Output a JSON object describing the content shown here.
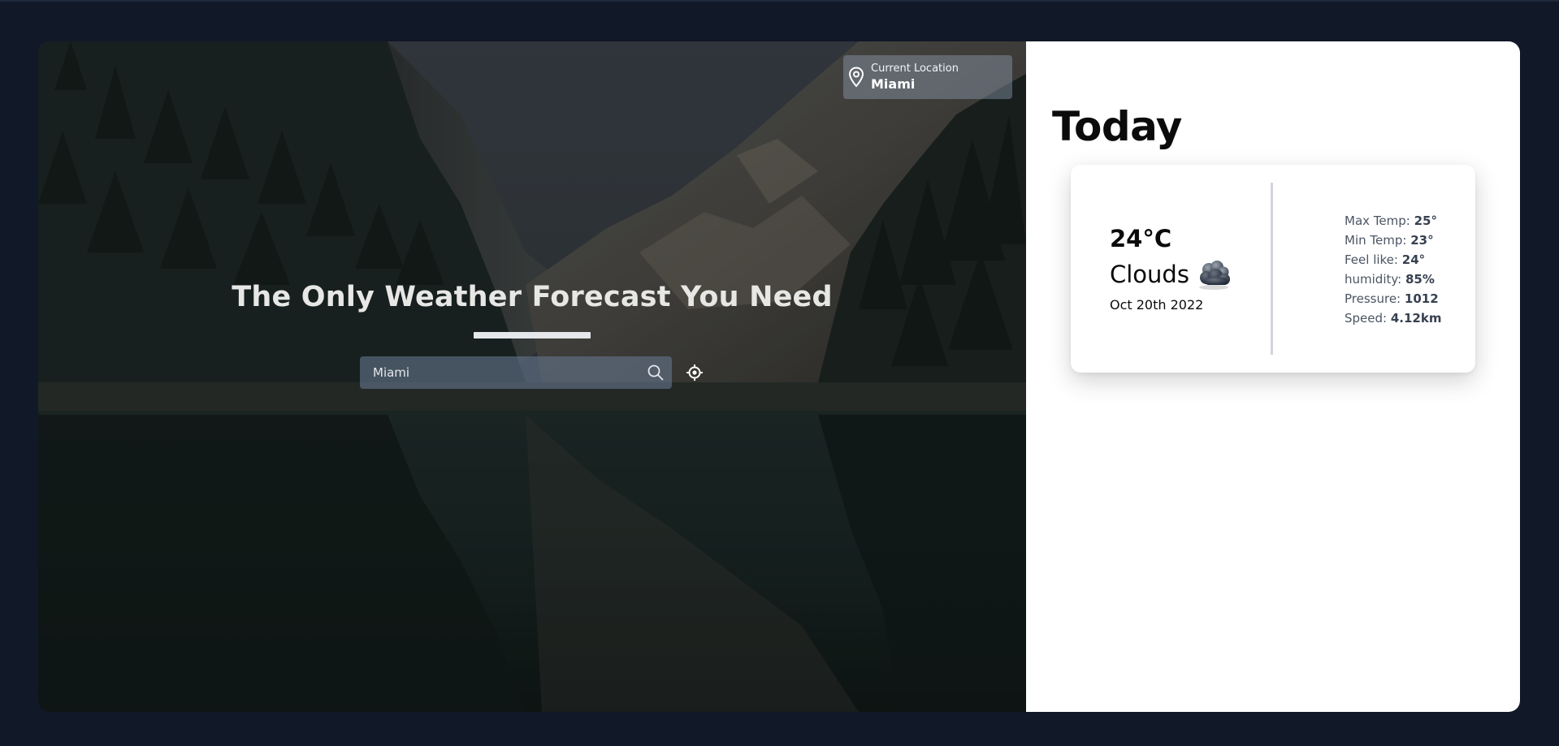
{
  "header": {
    "location_label": "Current Location",
    "location_city": "Miami"
  },
  "hero": {
    "headline": "The Only Weather Forecast You Need",
    "search": {
      "value": "Miami",
      "placeholder": "Miami"
    }
  },
  "today": {
    "title": "Today",
    "temperature": "24°C",
    "condition": "Clouds",
    "condition_icon": "clouds-icon",
    "date": "Oct 20th 2022",
    "stats": [
      {
        "label": "Max Temp:",
        "value": "25°"
      },
      {
        "label": "Min Temp:",
        "value": "23°"
      },
      {
        "label": "Feel like:",
        "value": "24°"
      },
      {
        "label": "humidity:",
        "value": "85%"
      },
      {
        "label": "Pressure:",
        "value": "1012"
      },
      {
        "label": "Speed:",
        "value": "4.12km"
      }
    ]
  },
  "colors": {
    "page_background": "#111827",
    "panel_background": "#ffffff",
    "location_box": "#94a3b8",
    "search_bar": "#64748b"
  }
}
